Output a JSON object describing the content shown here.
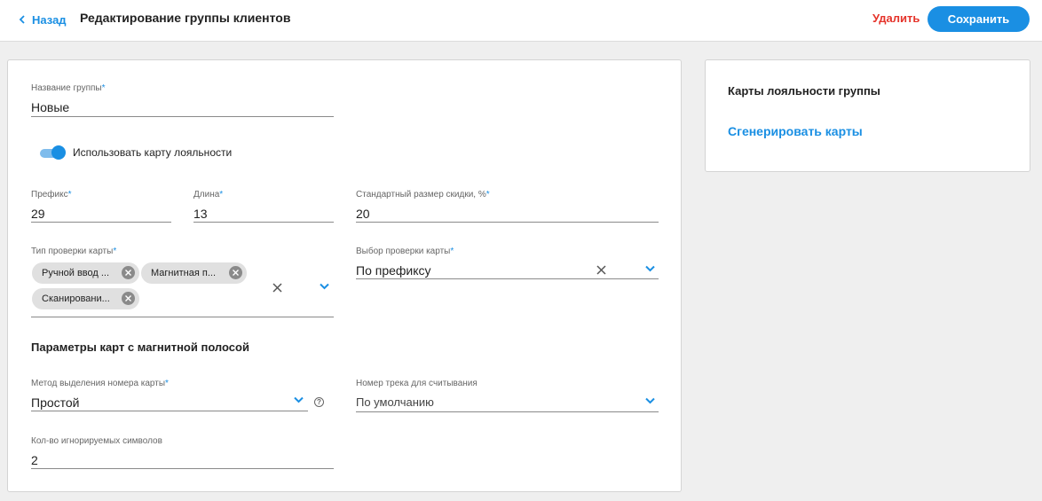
{
  "header": {
    "back_label": "Назад",
    "title": "Редактирование группы клиентов",
    "delete_label": "Удалить",
    "save_label": "Сохранить"
  },
  "form": {
    "group_name": {
      "label": "Название группы",
      "required_mark": "*",
      "value": "Новые"
    },
    "loyalty_toggle": {
      "label": "Использовать карту лояльности",
      "checked": true
    },
    "prefix": {
      "label": "Префикс",
      "required_mark": "*",
      "value": "29"
    },
    "length": {
      "label": "Длина",
      "required_mark": "*",
      "value": "13"
    },
    "discount": {
      "label": "Стандартный размер скидки, %",
      "required_mark": "*",
      "value": "20"
    },
    "check_type": {
      "label": "Тип проверки карты",
      "required_mark": "*",
      "chips": [
        "Ручной ввод ...",
        "Магнитная п...",
        "Сканировани..."
      ]
    },
    "check_select": {
      "label": "Выбор проверки карты",
      "required_mark": "*",
      "value": "По префиксу"
    },
    "magnetic_section_title": "Параметры карт с магнитной полосой",
    "extract_method": {
      "label": "Метод выделения номера карты",
      "required_mark": "*",
      "value": "Простой",
      "help_glyph": "?"
    },
    "track_number": {
      "label": "Номер трека для считывания",
      "value": "По умолчанию"
    },
    "ignored_chars": {
      "label": "Кол-во игнорируемых символов",
      "value": "2"
    }
  },
  "side": {
    "title": "Карты лояльности группы",
    "generate_label": "Сгенерировать карты"
  },
  "colors": {
    "accent": "#1a8fe3",
    "danger": "#e5332a",
    "background": "#efefef"
  },
  "icons": [
    "chevron-left-icon",
    "close-icon",
    "chevron-down-icon",
    "help-icon"
  ]
}
